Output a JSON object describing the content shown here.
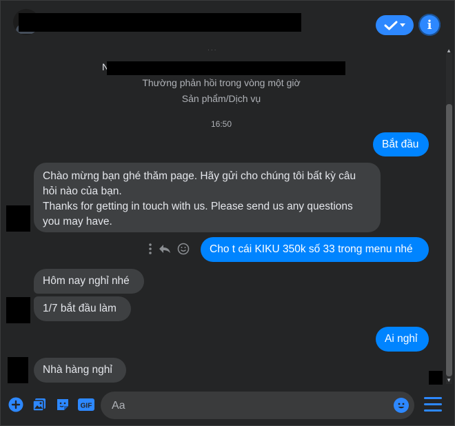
{
  "page": {
    "status_line": "Thường phản hồi trong vòng một giờ",
    "category": "Sản phẩm/Dịch vụ",
    "first_letter": "N"
  },
  "messages": {
    "time": "16:50",
    "m1": "Bắt đầu",
    "m2_line1": "Chào mừng bạn ghé thăm page. Hãy gửi cho chúng tôi bất kỳ câu",
    "m2_line2": "hỏi nào của bạn.",
    "m2_line3": "Thanks for getting in touch with us. Please send us any questions",
    "m2_line4": "you may have.",
    "m3": "Cho t cái KIKU 350k số 33 trong menu nhé",
    "m4": "Hôm nay nghỉ nhé",
    "m5": "1/7 bắt đầu làm",
    "m6": "Ai nghỉ",
    "m7": "Nhà hàng nghỉ"
  },
  "composer": {
    "placeholder": "Aa",
    "gif_label": "GIF"
  },
  "colors": {
    "accent": "#2d88ff",
    "outgoing_bubble": "#0084ff",
    "incoming_bubble": "#3e4042",
    "background": "#242526"
  },
  "icons": [
    "check-icon",
    "chevron-down-icon",
    "info-icon",
    "more-vertical-icon",
    "reply-icon",
    "emoji-reaction-icon",
    "add-icon",
    "photo-icon",
    "sticker-icon",
    "gif-icon",
    "emoji-icon",
    "menu-icon"
  ]
}
